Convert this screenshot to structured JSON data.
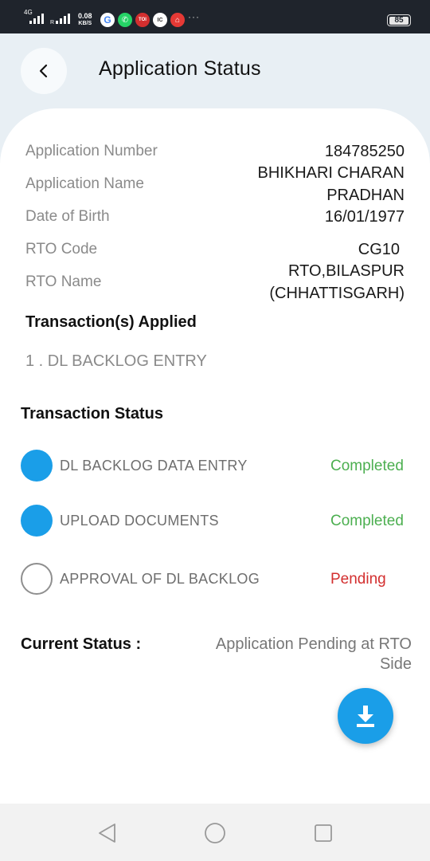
{
  "status_bar": {
    "network": "4G",
    "roaming": "R",
    "speed_value": "0.08",
    "speed_unit": "KB/S",
    "battery": "85",
    "dots": "···",
    "app_icons": [
      {
        "name": "google-icon",
        "glyph": "G",
        "color": "#4285f4"
      },
      {
        "name": "whatsapp-icon",
        "glyph": "✆",
        "color": "#25d366"
      },
      {
        "name": "toi-icon",
        "glyph": "TOI",
        "color": "#d32f2f"
      },
      {
        "name": "ic-app-icon",
        "glyph": "IC",
        "color": "#333333"
      },
      {
        "name": "app-red-icon",
        "glyph": "⌂",
        "color": "#e53935"
      }
    ]
  },
  "header": {
    "title": "Application Status",
    "back_icon": "chevron-left-icon"
  },
  "details": {
    "application_number_label": "Application Number",
    "application_number": "184785250",
    "application_name_label": "Application Name",
    "application_name_line1": "BHIKHARI CHARAN",
    "application_name_line2": "PRADHAN",
    "dob_label": "Date of Birth",
    "dob": "16/01/1977",
    "rto_code_label": "RTO Code",
    "rto_code": "CG10",
    "rto_name_label": "RTO Name",
    "rto_name_line1": "RTO,BILASPUR",
    "rto_name_line2": "(CHHATTISGARH)"
  },
  "transactions": {
    "heading": "Transaction(s) Applied",
    "items": [
      "1 . DL BACKLOG ENTRY"
    ]
  },
  "transaction_status": {
    "heading": "Transaction Status",
    "stages": [
      {
        "name": "DL BACKLOG DATA ENTRY",
        "status": "Completed",
        "done": true
      },
      {
        "name": "UPLOAD DOCUMENTS",
        "status": "Completed",
        "done": true
      },
      {
        "name": "APPROVAL OF DL BACKLOG",
        "status": "Pending",
        "done": false
      }
    ]
  },
  "current_status": {
    "label": "Current Status :",
    "value_line1": "Application Pending at RTO",
    "value_line2": "Side"
  },
  "fab": {
    "icon": "download-icon"
  },
  "colors": {
    "accent": "#1a9ee8",
    "completed": "#4caf50",
    "pending": "#d32f2f",
    "background": "#e8eff4"
  }
}
